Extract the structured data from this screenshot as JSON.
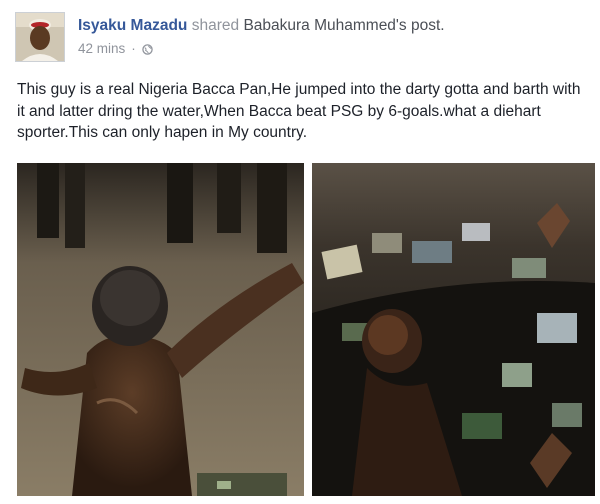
{
  "post": {
    "author_name": "Isyaku Mazadu",
    "action_text": "shared",
    "original_poster": "Babakura Muhammed's post.",
    "timestamp": "42 mins",
    "separator": "·",
    "privacy_icon": "globe-icon",
    "body": "This guy is a real Nigeria Bacca Pan,He jumped into the darty gotta and barth with it and latter dring the water,When Bacca beat PSG by 6-goals.what a diehart sporter.This can only hapen in My country."
  },
  "photos": [
    {
      "subject": "man-raising-arms-photo"
    },
    {
      "subject": "man-in-gutter-photo"
    }
  ],
  "colors": {
    "link": "#365899",
    "meta": "#90949c",
    "text": "#1d2129"
  }
}
